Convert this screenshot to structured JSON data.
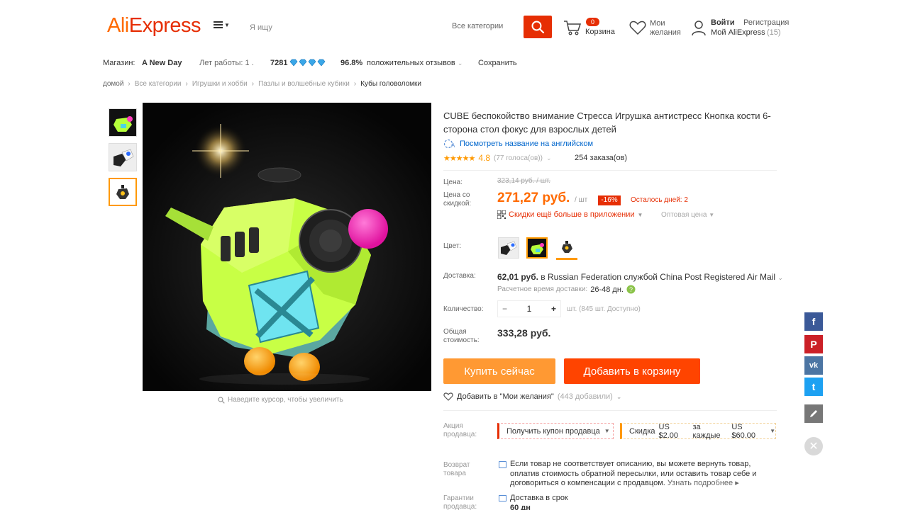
{
  "header": {
    "logo_ali": "Ali",
    "logo_express": "Express",
    "search_placeholder": "Я ищу",
    "search_category": "Все категории",
    "cart_count": "0",
    "cart_label": "Корзина",
    "wishlist_line1": "Мои",
    "wishlist_line2": "желания",
    "login": "Войти",
    "register": "Регистрация",
    "my_aliexpress": "Мой AliExpress",
    "my_aliexpress_count": "(15)"
  },
  "store": {
    "label": "Магазин:",
    "name": "A New Day",
    "years": "Лет работы: 1 .",
    "score": "7281",
    "positive_pct": "96.8%",
    "positive_label": "положительных отзывов",
    "save": "Сохранить"
  },
  "breadcrumb": [
    "домой",
    "Все категории",
    "Игрушки и хобби",
    "Пазлы и волшебные кубики",
    "Кубы головоломки"
  ],
  "gallery": {
    "zoom_hint": "Наведите курсор, чтобы увеличить"
  },
  "product": {
    "title": "CUBE беспокойство внимание Стресса Игрушка антистресс Кнопка кости 6-сторона стол фокус для взрослых детей",
    "translate_link": "Посмотреть название на английском",
    "stars": "★★★★★",
    "rating": "4.8",
    "votes": "(77 голоса(ов))",
    "orders": "254 заказа(ов)",
    "price_label": "Цена:",
    "old_price": "323,14 руб. / шт.",
    "sale_price_label_1": "Цена со",
    "sale_price_label_2": "скидкой:",
    "price": "271,27 руб.",
    "per_unit": "/ шт",
    "discount": "-16%",
    "days_left": "Осталось дней: 2",
    "app_discount": "Скидки ещё больше в приложении",
    "wholesale": "Оптовая цена",
    "color_label": "Цвет:",
    "shipping_label": "Доставка:",
    "shipping_price": "62,01 руб.",
    "shipping_text": " в Russian Federation службой China Post Registered Air Mail",
    "shipping_time_label": "Расчетное время доставки:",
    "shipping_time": "26-48 дн.",
    "qty_label": "Количество:",
    "qty_minus": "−",
    "qty_value": "1",
    "qty_plus": "+",
    "qty_available": "шт. (845 шт. Доступно)",
    "total_label_1": "Общая",
    "total_label_2": "стоимость:",
    "total": "333,28 руб.",
    "buy_now": "Купить сейчас",
    "add_to_cart": "Добавить в корзину",
    "wish_add": "Добавить в \"Мои желания\"",
    "wish_count": "(443 добавили)"
  },
  "promo": {
    "label_1": "Акция",
    "label_2": "продавца:",
    "coupon": "Получить купон продавца",
    "sale_text": "Скидка",
    "sale_amount": "US $2.00",
    "sale_mid": "за каждые",
    "sale_threshold": "US $60.00"
  },
  "returns": {
    "label_1": "Возврат",
    "label_2": "товара",
    "text": "Если товар не соответствует описанию, вы можете вернуть товар, оплатив стоимость обратной пересылки, или оставить товар себе и договориться о компенсации с продавцом.",
    "more": "Узнать подробнее ▸"
  },
  "guarantee": {
    "label_1": "Гарантии",
    "label_2": "продавца:",
    "text": "Доставка в срок",
    "days": "60 дн"
  },
  "social": {
    "facebook": "f",
    "pinterest": "P",
    "vk": "vk",
    "twitter": "t",
    "close": "✕"
  },
  "colors": {
    "brand_orange": "#ff6a00",
    "brand_red": "#e62e04",
    "buy_now_bg": "#ff9933",
    "add_cart_bg": "#ff4400",
    "facebook": "#3b5998",
    "pinterest": "#cb2027",
    "vk": "#4c75a3",
    "twitter": "#1da1f2",
    "edit": "#777777"
  }
}
